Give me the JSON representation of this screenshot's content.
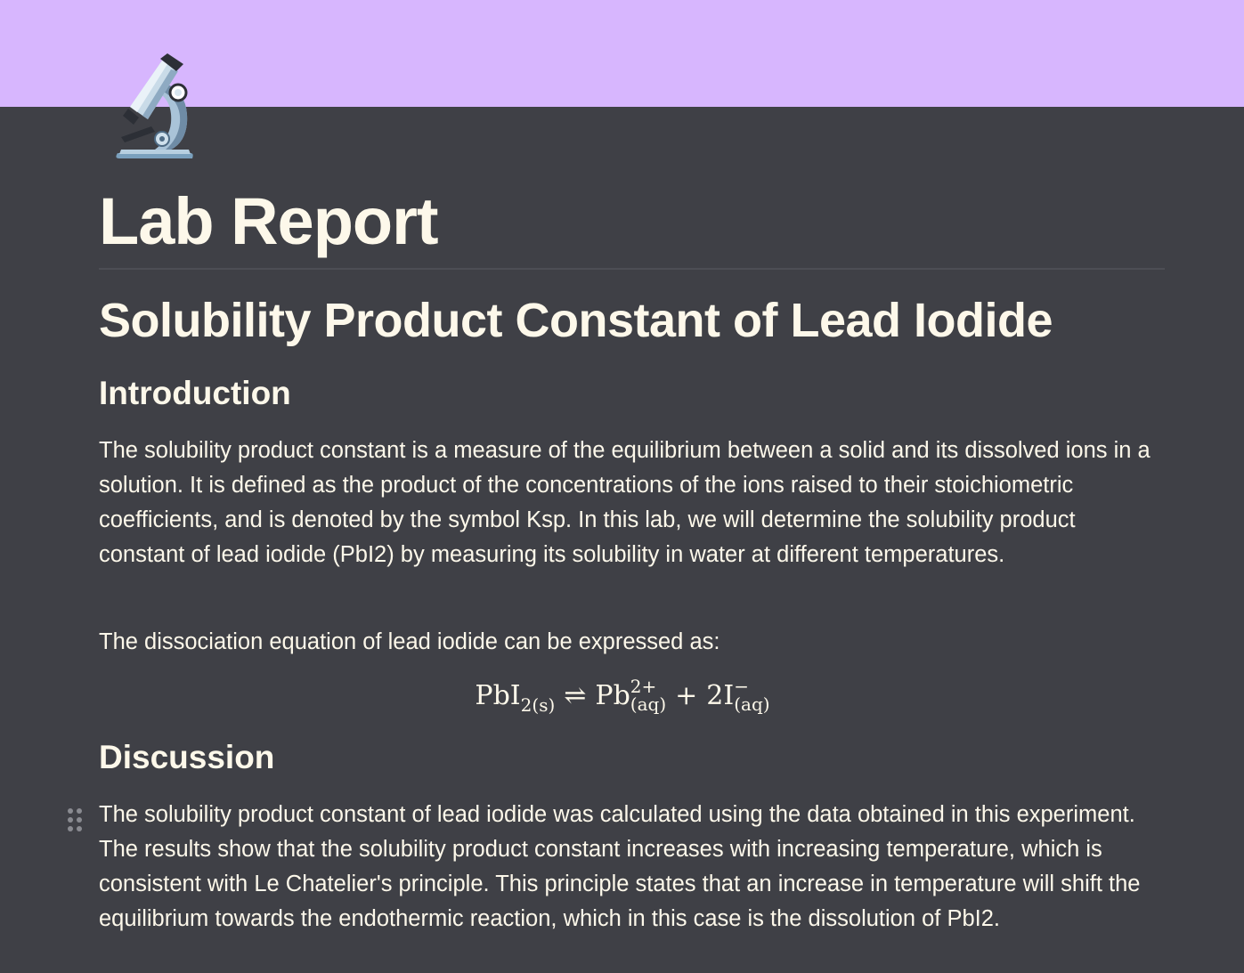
{
  "cover": {
    "color": "#d7b6fe"
  },
  "page": {
    "icon": "microscope-icon",
    "title": "Lab Report"
  },
  "heading1": "Solubility Product Constant of Lead Iodide",
  "introduction": {
    "heading": "Introduction",
    "paragraph": "The solubility product constant is a measure of the equilibrium between a solid and its dissolved ions in a solution. It is defined as the product of the concentrations of the ions raised to their stoichiometric coefficients, and is denoted by the symbol Ksp. In this lab, we will determine the solubility product constant of lead iodide (PbI2) by measuring its solubility in water at different temperatures.",
    "equation_intro": "The dissociation equation of lead iodide can be expressed as:",
    "equation": {
      "reactant": "PbI",
      "reactant_sub": "2(s)",
      "arrow": "⇌",
      "product1": "Pb",
      "product1_sup": "2+",
      "product1_sub": "(aq)",
      "plus": "+",
      "product2": "2I",
      "product2_sup": "−",
      "product2_sub": "(aq)"
    }
  },
  "discussion": {
    "heading": "Discussion",
    "paragraph": "The solubility product constant of lead iodide was calculated using the data obtained in this experiment. The results show that the solubility product constant increases with increasing temperature, which is consistent with Le Chatelier's principle. This principle states that an increase in temperature will shift the equilibrium towards the endothermic reaction, which in this case is the dissolution of PbI2."
  },
  "colors": {
    "background": "#3f4046",
    "text": "#fdf8ea",
    "cover": "#d7b6fe"
  }
}
